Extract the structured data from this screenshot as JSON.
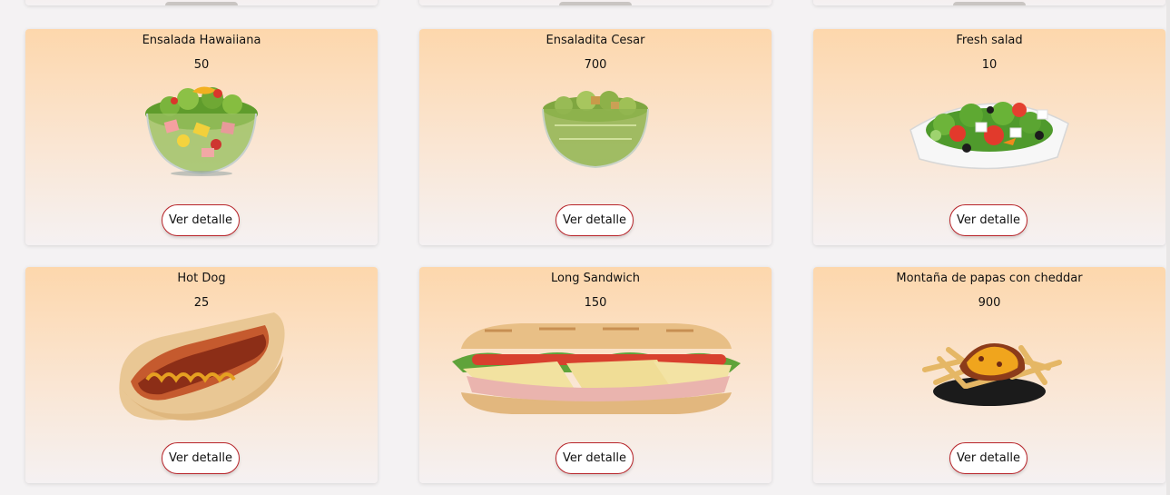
{
  "products": [
    {
      "name": "Ensalada Hawaiiana",
      "price": "50",
      "button": "Ver detalle"
    },
    {
      "name": "Ensaladita Cesar",
      "price": "700",
      "button": "Ver detalle"
    },
    {
      "name": "Fresh salad",
      "price": "10",
      "button": "Ver detalle"
    },
    {
      "name": "Hot Dog",
      "price": "25",
      "button": "Ver detalle"
    },
    {
      "name": "Long Sandwich",
      "price": "150",
      "button": "Ver detalle"
    },
    {
      "name": "Montaña de papas con cheddar",
      "price": "900",
      "button": "Ver detalle"
    }
  ]
}
